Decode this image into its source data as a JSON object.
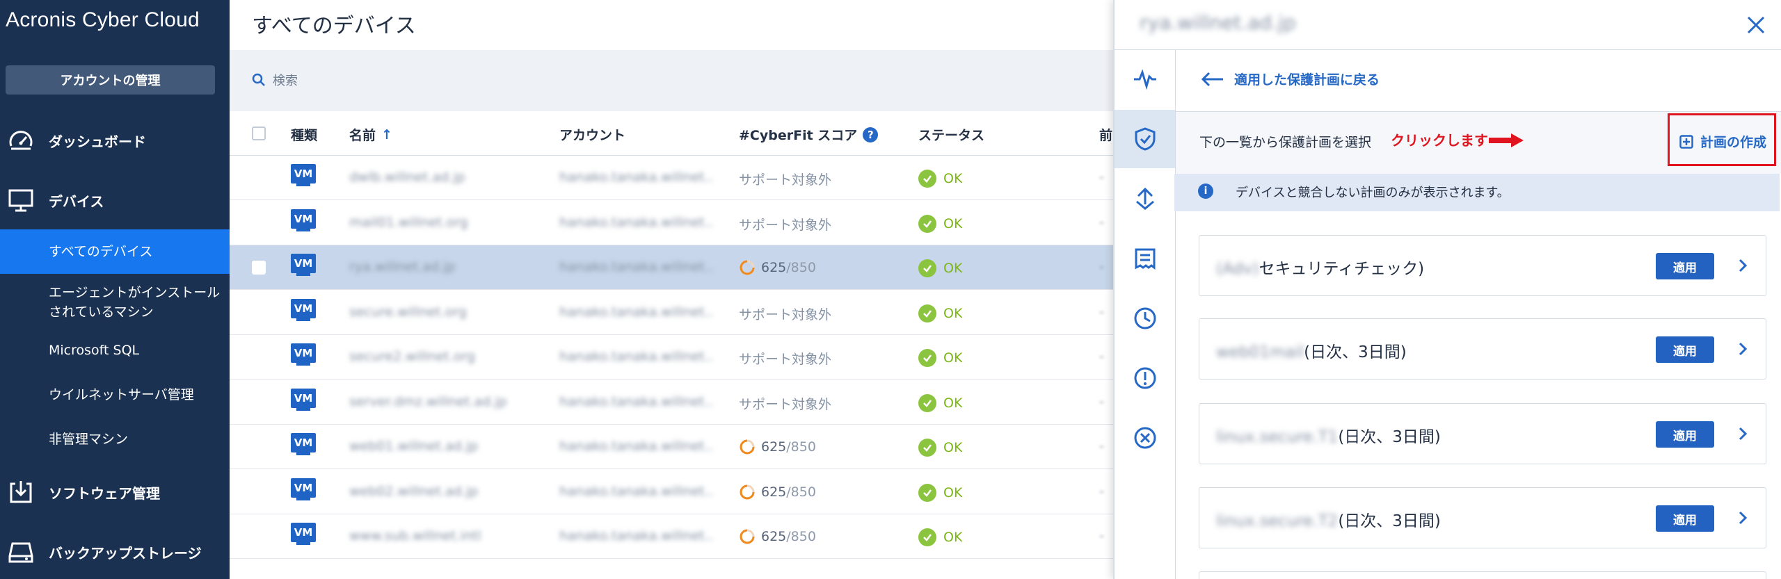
{
  "sidebar": {
    "brand": "Acronis Cyber Cloud",
    "account_button": "アカウントの管理",
    "nav": [
      {
        "label": "ダッシュボード",
        "icon": "dashboard-icon"
      },
      {
        "label": "デバイス",
        "icon": "monitor-icon"
      },
      {
        "label": "ソフトウェア管理",
        "icon": "download-tray-icon"
      },
      {
        "label": "バックアップストレージ",
        "icon": "storage-icon"
      }
    ],
    "subnav": [
      {
        "label": "すべてのデバイス",
        "active": true
      },
      {
        "label": "エージェントがインストールされているマシン",
        "active": false
      },
      {
        "label": "Microsoft SQL",
        "active": false
      },
      {
        "label": "ウイルネットサーバ管理",
        "active": false
      },
      {
        "label": "非管理マシン",
        "active": false
      }
    ]
  },
  "main": {
    "title": "すべてのデバイス",
    "search_placeholder": "検索",
    "columns": {
      "type": "種類",
      "name": "名前",
      "account": "アカウント",
      "score": "#CyberFit スコア",
      "status": "ステータス",
      "last": "前"
    },
    "sort_indicator": "↑",
    "rows": [
      {
        "type": "VM",
        "name": "dwlb.willnet.ad.jp",
        "account": "hanako.tanaka.willnet…",
        "score": "サポート対象外",
        "score_value": null,
        "status": "OK",
        "last": "-",
        "selected": false
      },
      {
        "type": "VM",
        "name": "mail01.willnet.org",
        "account": "hanako.tanaka.willnet…",
        "score": "サポート対象外",
        "score_value": null,
        "status": "OK",
        "last": "-",
        "selected": false
      },
      {
        "type": "VM",
        "name": "rya.willnet.ad.jp",
        "account": "hanako.tanaka.willnet…",
        "score": "625/850",
        "score_value": 625,
        "score_max": "850",
        "status": "OK",
        "last": "-",
        "selected": true
      },
      {
        "type": "VM",
        "name": "secure.willnet.org",
        "account": "hanako.tanaka.willnet…",
        "score": "サポート対象外",
        "score_value": null,
        "status": "OK",
        "last": "-",
        "selected": false
      },
      {
        "type": "VM",
        "name": "secure2.willnet.org",
        "account": "hanako.tanaka.willnet…",
        "score": "サポート対象外",
        "score_value": null,
        "status": "OK",
        "last": "-",
        "selected": false
      },
      {
        "type": "VM",
        "name": "server.dmz.willnet.ad.jp",
        "account": "hanako.tanaka.willnet…",
        "score": "サポート対象外",
        "score_value": null,
        "status": "OK",
        "last": "-",
        "selected": false
      },
      {
        "type": "VM",
        "name": "web01.willnet.ad.jp",
        "account": "hanako.tanaka.willnet…",
        "score": "625/850",
        "score_value": 625,
        "score_max": "850",
        "status": "OK",
        "last": "-",
        "selected": false
      },
      {
        "type": "VM",
        "name": "web02.willnet.ad.jp",
        "account": "hanako.tanaka.willnet…",
        "score": "625/850",
        "score_value": 625,
        "score_max": "850",
        "status": "OK",
        "last": "-",
        "selected": false
      },
      {
        "type": "VM",
        "name": "www.sub.willnet.intl",
        "account": "hanako.tanaka.willnet…",
        "score": "625/850",
        "score_value": 625,
        "score_max": "850",
        "status": "OK",
        "last": "-",
        "selected": false
      }
    ]
  },
  "panel": {
    "title": "rya.willnet.ad.jp",
    "rail_icons": [
      "activity-icon",
      "shield-check-icon",
      "recovery-icon",
      "report-icon",
      "clock-icon",
      "alert-icon",
      "cancel-icon"
    ],
    "back_link": "適用した保護計画に戻る",
    "select_text": "下の一覧から保護計画を選択",
    "annotation": "クリックします",
    "create_plan": "計画の作成",
    "info_text": "デバイスと競合しない計画のみが表示されます。",
    "plans": [
      {
        "name_blur": "(Adv)",
        "name_text": "セキュリティチェック)",
        "apply": "適用"
      },
      {
        "name_blur": "web01mail",
        "name_text": "(日次、3日間)",
        "apply": "適用"
      },
      {
        "name_blur": "linux.secure.T1",
        "name_text": "(日次、3日間)",
        "apply": "適用"
      },
      {
        "name_blur": "linux.secure.T2",
        "name_text": "(日次、3日間)",
        "apply": "適用"
      }
    ]
  },
  "colors": {
    "sidebar_bg": "#1b3152",
    "active_nav": "#1677ee",
    "primary_blue": "#2362c0",
    "ok_green": "#8bc53f",
    "score_orange": "#f08a1c",
    "annotation_red": "#e0141e"
  }
}
